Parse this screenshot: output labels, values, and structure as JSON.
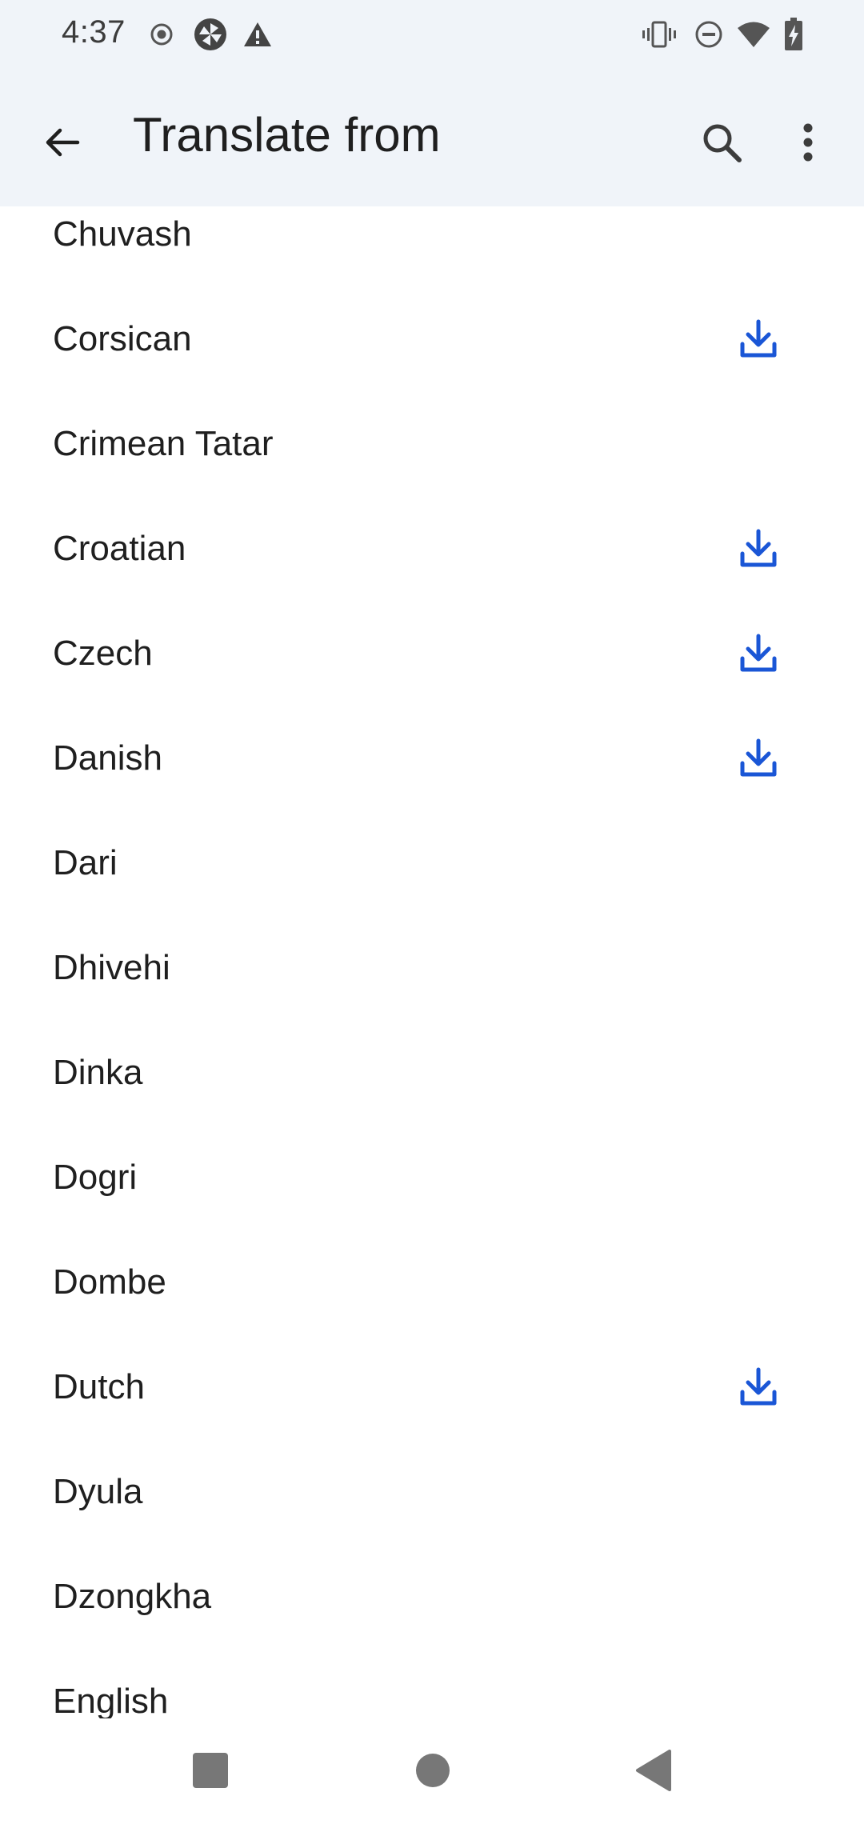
{
  "status_bar": {
    "time": "4:37",
    "left_icons": [
      "record-icon",
      "camera-shutter-icon",
      "warning-icon"
    ],
    "right_icons": [
      "vibrate-icon",
      "do-not-disturb-icon",
      "wifi-icon",
      "battery-charging-icon"
    ]
  },
  "app_bar": {
    "title": "Translate from",
    "back_icon": "arrow-back-icon",
    "search_icon": "search-icon",
    "more_icon": "more-vert-icon"
  },
  "languages": [
    {
      "name": "Chuvash",
      "downloadable": false
    },
    {
      "name": "Corsican",
      "downloadable": true
    },
    {
      "name": "Crimean Tatar",
      "downloadable": false
    },
    {
      "name": "Croatian",
      "downloadable": true
    },
    {
      "name": "Czech",
      "downloadable": true
    },
    {
      "name": "Danish",
      "downloadable": true
    },
    {
      "name": "Dari",
      "downloadable": false
    },
    {
      "name": "Dhivehi",
      "downloadable": false
    },
    {
      "name": "Dinka",
      "downloadable": false
    },
    {
      "name": "Dogri",
      "downloadable": false
    },
    {
      "name": "Dombe",
      "downloadable": false
    },
    {
      "name": "Dutch",
      "downloadable": true
    },
    {
      "name": "Dyula",
      "downloadable": false
    },
    {
      "name": "Dzongkha",
      "downloadable": false
    },
    {
      "name": "English",
      "downloadable": false
    }
  ],
  "colors": {
    "header_bg": "#f0f4f9",
    "accent": "#1a56d6",
    "text": "#1f1f1f"
  },
  "nav_bar": {
    "recents_icon": "recents-square-icon",
    "home_icon": "home-circle-icon",
    "back_icon": "back-triangle-icon"
  }
}
